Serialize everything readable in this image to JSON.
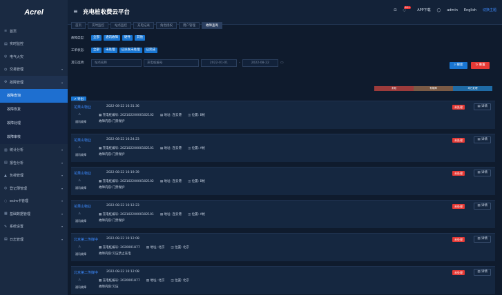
{
  "logo": "Acrel",
  "app_title": "充电桩收费云平台",
  "topbar": {
    "app_download": "APP下载",
    "badge": "99+",
    "user": "admin",
    "lang_en": "English",
    "lang_theme": "切换主题"
  },
  "sidebar": {
    "items": [
      {
        "label": "首页",
        "icon": "≡"
      },
      {
        "label": "实时监控",
        "icon": "▤"
      },
      {
        "label": "电气火灾",
        "icon": "◎"
      },
      {
        "label": "交易管理",
        "icon": "◷"
      },
      {
        "label": "故障管理",
        "icon": "⚙"
      }
    ],
    "sub_items": [
      {
        "label": "故障查询"
      },
      {
        "label": "故障恢复"
      },
      {
        "label": "故障处理"
      },
      {
        "label": "故障审核"
      }
    ],
    "more": [
      {
        "label": "统计分析",
        "icon": "▥"
      },
      {
        "label": "报告分析",
        "icon": "▤"
      },
      {
        "label": "负荷管理",
        "icon": "▲"
      },
      {
        "label": "登记薄管理",
        "icon": "◎"
      },
      {
        "label": "esim卡管理",
        "icon": "◌"
      },
      {
        "label": "基础数据管理",
        "icon": "▦"
      },
      {
        "label": "系统设置",
        "icon": "✎"
      },
      {
        "label": "日志管理",
        "icon": "▤"
      }
    ]
  },
  "tabs": [
    "首页",
    "实时监控",
    "站点监控",
    "充电记录",
    "角色授权",
    "用户管理",
    "故障查询"
  ],
  "filters": {
    "type_label": "故障类型:",
    "type_chips": [
      "全部",
      "通讯故障",
      "硬件",
      "其他"
    ],
    "status_label": "工单状态:",
    "status_chips": [
      "全部",
      "未处理",
      "已派发未处理",
      "已完成"
    ],
    "other_label": "其它选项:",
    "station_ph": "站点名称",
    "pile_ph": "充电桩编号",
    "date_from": "2022-01-01",
    "date_to": "2022-08-22",
    "search": "搜索",
    "reset": "重置",
    "export": "导出"
  },
  "legend": {
    "items": [
      "未知",
      "有故障",
      "均已处理"
    ],
    "colors": [
      "#9c3b3b",
      "#7a5a45",
      "#1f6ba5"
    ]
  },
  "records": [
    {
      "loc": "花果山物业",
      "time": "2022-08-22 16:31:36",
      "pile": "充电桩编号: 20210220000102102",
      "addr": "地址: 连云港",
      "pos": "位置: B枪",
      "desc": "故障内容:门禁保护",
      "type": "通讯故障",
      "status": "未处理",
      "detail": "详情"
    },
    {
      "loc": "花果山物业",
      "time": "2022-08-22 16:24:23",
      "pile": "充电桩编号: 20210220000102101",
      "addr": "地址: 连云港",
      "pos": "位置: A枪",
      "desc": "故障内容:门禁保护",
      "type": "通讯故障",
      "status": "未处理",
      "detail": "详情"
    },
    {
      "loc": "花果山物业",
      "time": "2022-08-22 16:19:39",
      "pile": "充电桩编号: 20210220000102102",
      "addr": "地址: 连云港",
      "pos": "位置: B枪",
      "desc": "故障内容:门禁保护",
      "type": "通讯故障",
      "status": "未处理",
      "detail": "详情"
    },
    {
      "loc": "花果山物业",
      "time": "2022-08-22 16:12:23",
      "pile": "充电桩编号: 20210220000102101",
      "addr": "地址: 连云港",
      "pos": "位置: A枪",
      "desc": "故障内容:门禁保护",
      "type": "通讯故障",
      "status": "未处理",
      "detail": "详情"
    },
    {
      "loc": "北京第二传媒中",
      "time": "2022-08-22 16:12:08",
      "pile": "充电桩编号: 2020001877",
      "addr": "地址: 北京",
      "pos": "位置: 北京",
      "desc": "故障内容:欠压禁止充电",
      "type": "通讯故障",
      "status": "未处理",
      "detail": "详情"
    },
    {
      "loc": "北京第二传媒中",
      "time": "2022-08-22 16:12:08",
      "pile": "充电桩编号: 2020001877",
      "addr": "地址: 北京",
      "pos": "位置: 北京",
      "desc": "故障内容:欠压",
      "type": "通讯故障",
      "status": "未处理",
      "detail": "详情"
    }
  ]
}
